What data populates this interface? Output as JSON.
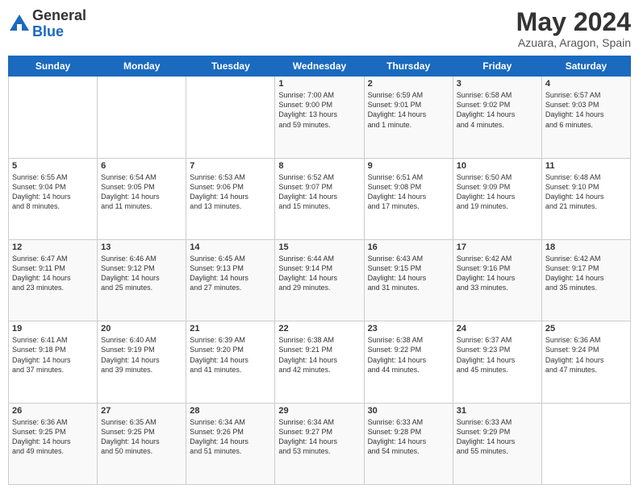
{
  "logo": {
    "general": "General",
    "blue": "Blue"
  },
  "header": {
    "title": "May 2024",
    "subtitle": "Azuara, Aragon, Spain"
  },
  "days_of_week": [
    "Sunday",
    "Monday",
    "Tuesday",
    "Wednesday",
    "Thursday",
    "Friday",
    "Saturday"
  ],
  "weeks": [
    [
      {
        "day": "",
        "content": ""
      },
      {
        "day": "",
        "content": ""
      },
      {
        "day": "",
        "content": ""
      },
      {
        "day": "1",
        "content": "Sunrise: 7:00 AM\nSunset: 9:00 PM\nDaylight: 13 hours\nand 59 minutes."
      },
      {
        "day": "2",
        "content": "Sunrise: 6:59 AM\nSunset: 9:01 PM\nDaylight: 14 hours\nand 1 minute."
      },
      {
        "day": "3",
        "content": "Sunrise: 6:58 AM\nSunset: 9:02 PM\nDaylight: 14 hours\nand 4 minutes."
      },
      {
        "day": "4",
        "content": "Sunrise: 6:57 AM\nSunset: 9:03 PM\nDaylight: 14 hours\nand 6 minutes."
      }
    ],
    [
      {
        "day": "5",
        "content": "Sunrise: 6:55 AM\nSunset: 9:04 PM\nDaylight: 14 hours\nand 8 minutes."
      },
      {
        "day": "6",
        "content": "Sunrise: 6:54 AM\nSunset: 9:05 PM\nDaylight: 14 hours\nand 11 minutes."
      },
      {
        "day": "7",
        "content": "Sunrise: 6:53 AM\nSunset: 9:06 PM\nDaylight: 14 hours\nand 13 minutes."
      },
      {
        "day": "8",
        "content": "Sunrise: 6:52 AM\nSunset: 9:07 PM\nDaylight: 14 hours\nand 15 minutes."
      },
      {
        "day": "9",
        "content": "Sunrise: 6:51 AM\nSunset: 9:08 PM\nDaylight: 14 hours\nand 17 minutes."
      },
      {
        "day": "10",
        "content": "Sunrise: 6:50 AM\nSunset: 9:09 PM\nDaylight: 14 hours\nand 19 minutes."
      },
      {
        "day": "11",
        "content": "Sunrise: 6:48 AM\nSunset: 9:10 PM\nDaylight: 14 hours\nand 21 minutes."
      }
    ],
    [
      {
        "day": "12",
        "content": "Sunrise: 6:47 AM\nSunset: 9:11 PM\nDaylight: 14 hours\nand 23 minutes."
      },
      {
        "day": "13",
        "content": "Sunrise: 6:46 AM\nSunset: 9:12 PM\nDaylight: 14 hours\nand 25 minutes."
      },
      {
        "day": "14",
        "content": "Sunrise: 6:45 AM\nSunset: 9:13 PM\nDaylight: 14 hours\nand 27 minutes."
      },
      {
        "day": "15",
        "content": "Sunrise: 6:44 AM\nSunset: 9:14 PM\nDaylight: 14 hours\nand 29 minutes."
      },
      {
        "day": "16",
        "content": "Sunrise: 6:43 AM\nSunset: 9:15 PM\nDaylight: 14 hours\nand 31 minutes."
      },
      {
        "day": "17",
        "content": "Sunrise: 6:42 AM\nSunset: 9:16 PM\nDaylight: 14 hours\nand 33 minutes."
      },
      {
        "day": "18",
        "content": "Sunrise: 6:42 AM\nSunset: 9:17 PM\nDaylight: 14 hours\nand 35 minutes."
      }
    ],
    [
      {
        "day": "19",
        "content": "Sunrise: 6:41 AM\nSunset: 9:18 PM\nDaylight: 14 hours\nand 37 minutes."
      },
      {
        "day": "20",
        "content": "Sunrise: 6:40 AM\nSunset: 9:19 PM\nDaylight: 14 hours\nand 39 minutes."
      },
      {
        "day": "21",
        "content": "Sunrise: 6:39 AM\nSunset: 9:20 PM\nDaylight: 14 hours\nand 41 minutes."
      },
      {
        "day": "22",
        "content": "Sunrise: 6:38 AM\nSunset: 9:21 PM\nDaylight: 14 hours\nand 42 minutes."
      },
      {
        "day": "23",
        "content": "Sunrise: 6:38 AM\nSunset: 9:22 PM\nDaylight: 14 hours\nand 44 minutes."
      },
      {
        "day": "24",
        "content": "Sunrise: 6:37 AM\nSunset: 9:23 PM\nDaylight: 14 hours\nand 45 minutes."
      },
      {
        "day": "25",
        "content": "Sunrise: 6:36 AM\nSunset: 9:24 PM\nDaylight: 14 hours\nand 47 minutes."
      }
    ],
    [
      {
        "day": "26",
        "content": "Sunrise: 6:36 AM\nSunset: 9:25 PM\nDaylight: 14 hours\nand 49 minutes."
      },
      {
        "day": "27",
        "content": "Sunrise: 6:35 AM\nSunset: 9:25 PM\nDaylight: 14 hours\nand 50 minutes."
      },
      {
        "day": "28",
        "content": "Sunrise: 6:34 AM\nSunset: 9:26 PM\nDaylight: 14 hours\nand 51 minutes."
      },
      {
        "day": "29",
        "content": "Sunrise: 6:34 AM\nSunset: 9:27 PM\nDaylight: 14 hours\nand 53 minutes."
      },
      {
        "day": "30",
        "content": "Sunrise: 6:33 AM\nSunset: 9:28 PM\nDaylight: 14 hours\nand 54 minutes."
      },
      {
        "day": "31",
        "content": "Sunrise: 6:33 AM\nSunset: 9:29 PM\nDaylight: 14 hours\nand 55 minutes."
      },
      {
        "day": "",
        "content": ""
      }
    ]
  ]
}
